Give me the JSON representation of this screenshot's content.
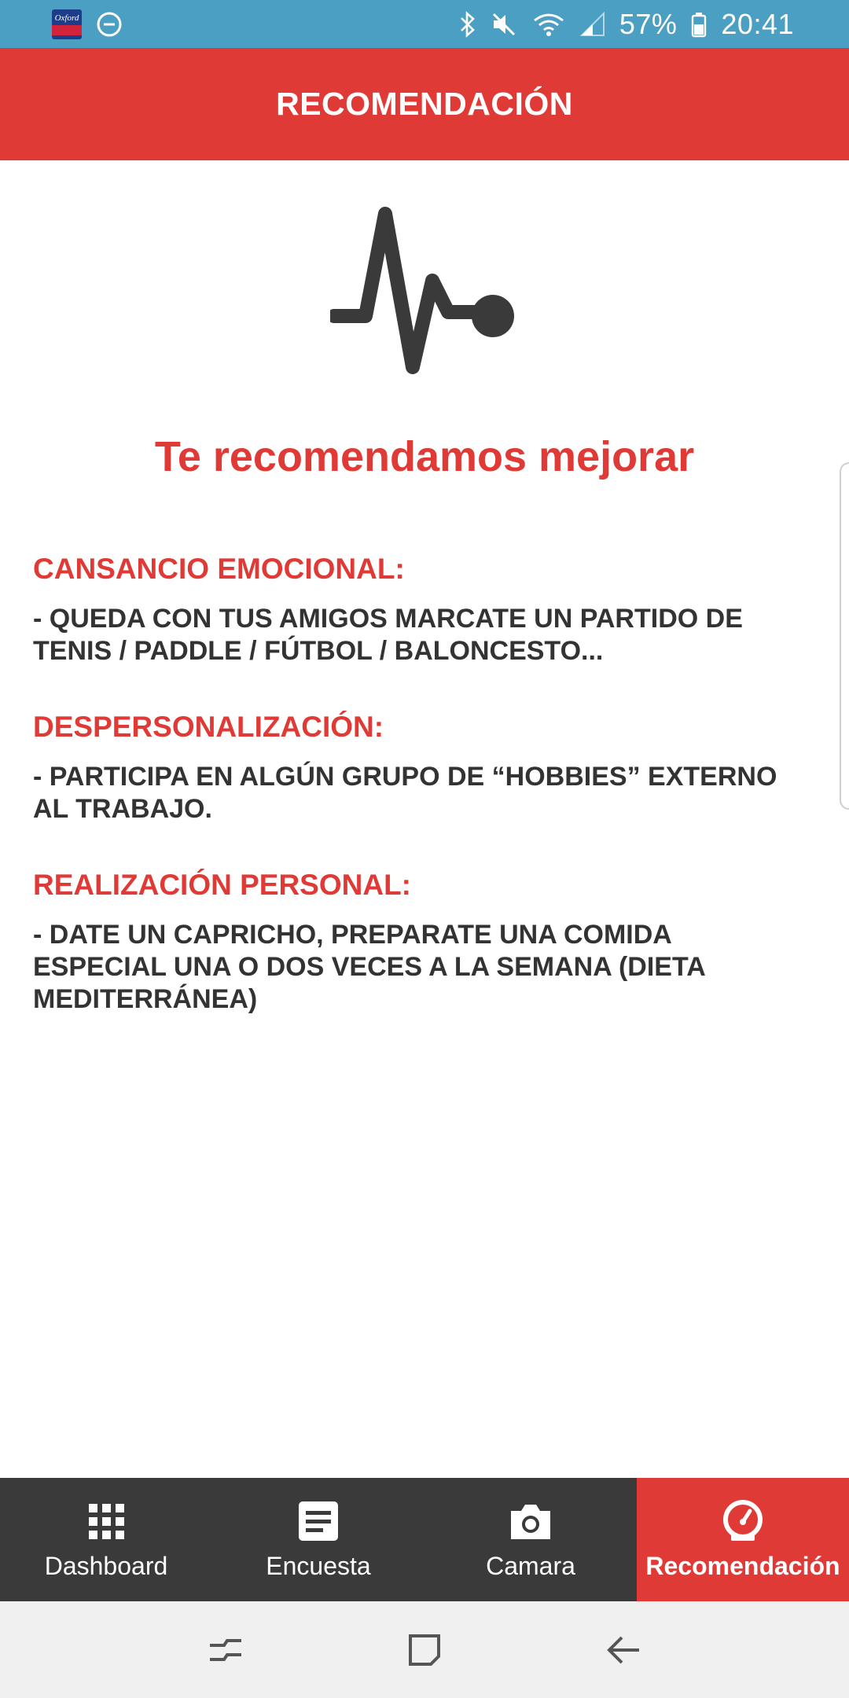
{
  "status_bar": {
    "app_badge_text": "Oxford",
    "battery_text": "57%",
    "time": "20:41",
    "icons": [
      "dnd-icon",
      "bluetooth-icon",
      "mute-icon",
      "wifi-icon",
      "signal-icon",
      "battery-icon"
    ]
  },
  "app_bar": {
    "title": "RECOMENDACIÓN"
  },
  "content": {
    "hero_icon": "heartbeat-icon",
    "headline": "Te recomendamos mejorar",
    "sections": [
      {
        "heading": "CANSANCIO EMOCIONAL:",
        "body": "- QUEDA CON TUS AMIGOS MARCATE UN PARTIDO DE TENIS / PADDLE / FÚTBOL / BALONCESTO..."
      },
      {
        "heading": "DESPERSONALIZACIÓN:",
        "body": "- PARTICIPA EN ALGÚN GRUPO DE “HOBBIES” EXTERNO AL TRABAJO."
      },
      {
        "heading": "REALIZACIÓN PERSONAL:",
        "body": "- DATE UN CAPRICHO, PREPARATE UNA COMIDA ESPECIAL UNA O DOS VECES A LA SEMANA (DIETA MEDITERRÁNEA)"
      }
    ]
  },
  "bottom_nav": {
    "items": [
      {
        "label": "Dashboard",
        "icon": "grid-icon",
        "active": false
      },
      {
        "label": "Encuesta",
        "icon": "document-icon",
        "active": false
      },
      {
        "label": "Camara",
        "icon": "camera-icon",
        "active": false
      },
      {
        "label": "Recomendación",
        "icon": "speedometer-icon",
        "active": true
      }
    ]
  },
  "colors": {
    "status_bar": "#4a9fc2",
    "accent": "#e03a36",
    "nav_background": "#3a3a3a",
    "body_text": "#333333"
  }
}
